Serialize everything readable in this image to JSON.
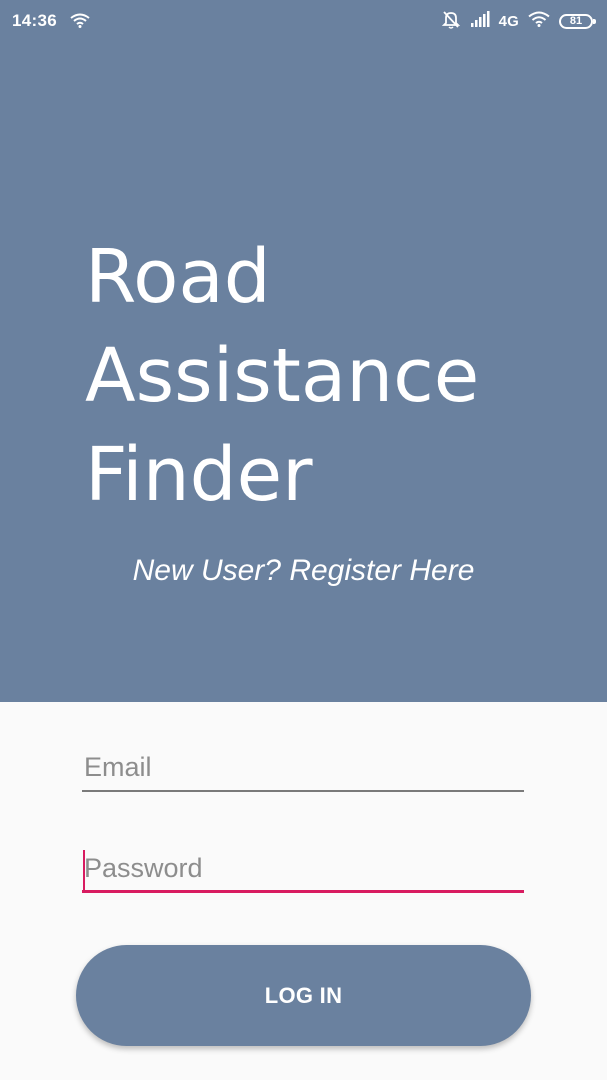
{
  "status_bar": {
    "time": "14:36",
    "network_type": "4G",
    "battery_level": "81",
    "icons": [
      "wifi-icon",
      "alarm-off-icon",
      "signal-icon",
      "wifi-icon",
      "battery-icon"
    ]
  },
  "hero": {
    "title_line1": "Road",
    "title_line2": "Assistance",
    "title_line3": "Finder",
    "register_link": "New User? Register Here"
  },
  "form": {
    "email_placeholder": "Email",
    "password_placeholder": "Password",
    "login_label": "LOG IN"
  },
  "colors": {
    "primary": "#6a819f",
    "accent": "#d81b60",
    "background": "#fafafa"
  }
}
